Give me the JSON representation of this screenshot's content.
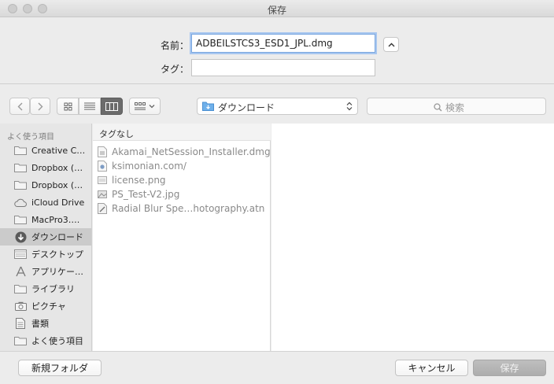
{
  "window": {
    "title": "保存"
  },
  "form": {
    "name_label": "名前：",
    "name_value": "ADBEILSTCS3_ESD1_JPL.dmg",
    "tag_label": "タグ：",
    "tag_value": ""
  },
  "toolbar": {
    "location": "ダウンロード",
    "search_placeholder": "検索"
  },
  "sidebar": {
    "heading": "よく使う項目",
    "items": [
      {
        "label": "Creative C…",
        "icon": "folder-icon"
      },
      {
        "label": "Dropbox (…",
        "icon": "folder-icon"
      },
      {
        "label": "Dropbox (…",
        "icon": "folder-icon"
      },
      {
        "label": "iCloud Drive",
        "icon": "cloud-icon"
      },
      {
        "label": "MacPro3….",
        "icon": "folder-icon"
      },
      {
        "label": "ダウンロード",
        "icon": "download-icon"
      },
      {
        "label": "デスクトップ",
        "icon": "desktop-icon"
      },
      {
        "label": "アプリケー…",
        "icon": "applications-icon"
      },
      {
        "label": "ライブラリ",
        "icon": "folder-icon"
      },
      {
        "label": "ピクチャ",
        "icon": "camera-icon"
      },
      {
        "label": "書類",
        "icon": "document-icon"
      },
      {
        "label": "よく使う項目",
        "icon": "folder-icon"
      }
    ],
    "selected_index": 5
  },
  "browser": {
    "column_header": "タグなし",
    "files": [
      {
        "name": "Akamai_NetSession_Installer.dmg",
        "icon": "dmg-file-icon"
      },
      {
        "name": "ksimonian.com/",
        "icon": "web-file-icon"
      },
      {
        "name": "license.png",
        "icon": "image-file-icon"
      },
      {
        "name": "PS_Test-V2.jpg",
        "icon": "image-file-icon"
      },
      {
        "name": "Radial Blur Spe…hotography.atn",
        "icon": "action-file-icon"
      }
    ]
  },
  "buttons": {
    "new_folder": "新規フォルダ",
    "cancel": "キャンセル",
    "save": "保存"
  },
  "colors": {
    "focus_ring": "#7aa7e0",
    "folder": "#8e8e8e",
    "selected_row": "#cbcbcb",
    "save_disabled": "#b4b4b4"
  }
}
